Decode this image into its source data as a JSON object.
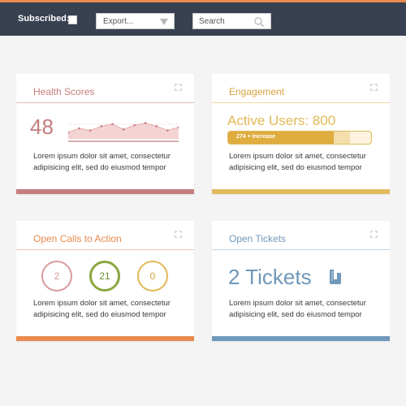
{
  "toolbar": {
    "subscribed_label": "Subscribed:",
    "export_label": "Export...",
    "search_placeholder": "Search"
  },
  "cards": [
    {
      "title": "Health Scores",
      "value": "48",
      "description": "Lorem ipsum dolor sit amet, consectetur adipisicing elit, sed do eiusmod tempor",
      "accent": "#c57d7d",
      "sparkline": [
        38,
        42,
        40,
        44,
        46,
        41,
        45,
        47,
        44,
        40,
        43
      ]
    },
    {
      "title": "Engagement",
      "active_users": "Active Users: 800",
      "progress_label": "274 + Increase",
      "progress_fraction": 0.74,
      "description": "Lorem ipsum dolor sit amet, consectetur adipisicing elit, sed do eiusmod tempor",
      "accent": "#e0ba5d"
    },
    {
      "title": "Open Calls to Action",
      "circles": [
        {
          "value": "2",
          "color": "#d99a9a"
        },
        {
          "value": "21",
          "color": "#8aa63f"
        },
        {
          "value": "0",
          "color": "#e3b855"
        }
      ],
      "description": "Lorem ipsum dolor sit amet, consectetur adipisicing elit, sed do eiusmod tempor",
      "accent": "#e98a4e"
    },
    {
      "title": "Open Tickets",
      "tickets": "2 Tickets",
      "description": "Lorem ipsum dolor sit amet, consectetur adipisicing elit, sed do eiusmod tempor",
      "accent": "#6f98bb"
    }
  ]
}
